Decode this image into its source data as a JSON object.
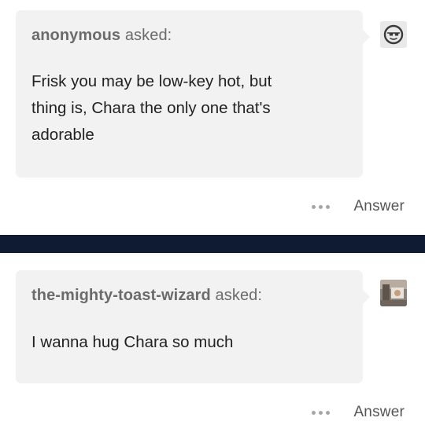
{
  "posts": [
    {
      "asker": "anonymous",
      "asked_label": "asked:",
      "question_lines": [
        "Frisk you may be low-key hot, but",
        "thing is, Chara the only one that's",
        "adorable"
      ],
      "avatar_icon": "sunglasses-face-icon",
      "answer_label": "Answer",
      "more_icon": "more-dots-icon"
    },
    {
      "asker": "the-mighty-toast-wizard",
      "asked_label": "asked:",
      "question_lines": [
        "I wanna hug Chara so much"
      ],
      "avatar_icon": "user-photo-avatar",
      "answer_label": "Answer",
      "more_icon": "more-dots-icon"
    }
  ],
  "colors": {
    "card_background": "#f2f2f2",
    "divider_band": "#0f1b33",
    "text_primary": "#222222",
    "text_secondary": "#6b6b6b"
  }
}
